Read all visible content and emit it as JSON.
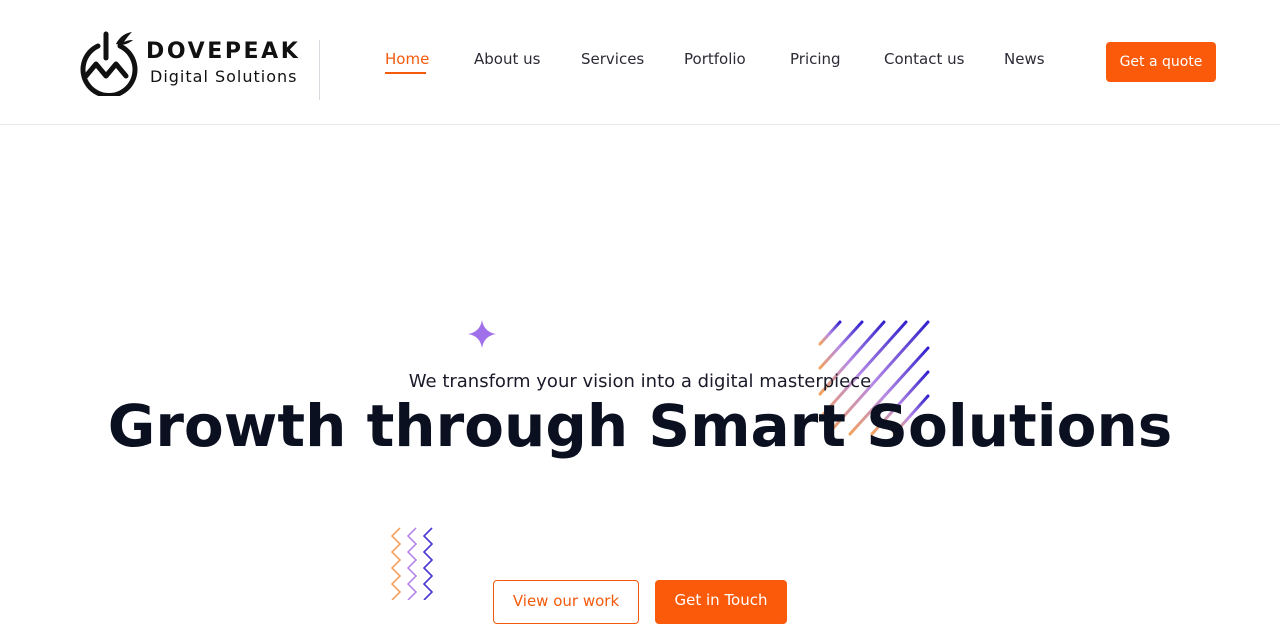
{
  "brand": {
    "name": "DOVEPEAK",
    "subtitle": "Digital Solutions",
    "logo_icon": "mountain-power-wing-logo"
  },
  "nav": {
    "items": [
      {
        "label": "Home",
        "active": true
      },
      {
        "label": "About us",
        "active": false
      },
      {
        "label": "Services",
        "active": false
      },
      {
        "label": "Portfolio",
        "active": false
      },
      {
        "label": "Pricing",
        "active": false
      },
      {
        "label": "Contact us",
        "active": false
      },
      {
        "label": "News",
        "active": false
      }
    ],
    "cta_label": "Get a quote"
  },
  "hero": {
    "tagline": "We transform your vision into a digital masterpiece",
    "title": "Growth through Smart Solutions",
    "primary_button": "View our work",
    "secondary_button": "Get in Touch"
  },
  "colors": {
    "accent": "#fa5a0a",
    "text_dark": "#0b1020",
    "purple": "#7b3fe0",
    "indigo": "#3b2bd0"
  },
  "decorations": {
    "sparkle": "four-point-star-icon",
    "stripes": "diagonal-stripes-icon",
    "zigzags": "zigzag-lines-icon"
  }
}
